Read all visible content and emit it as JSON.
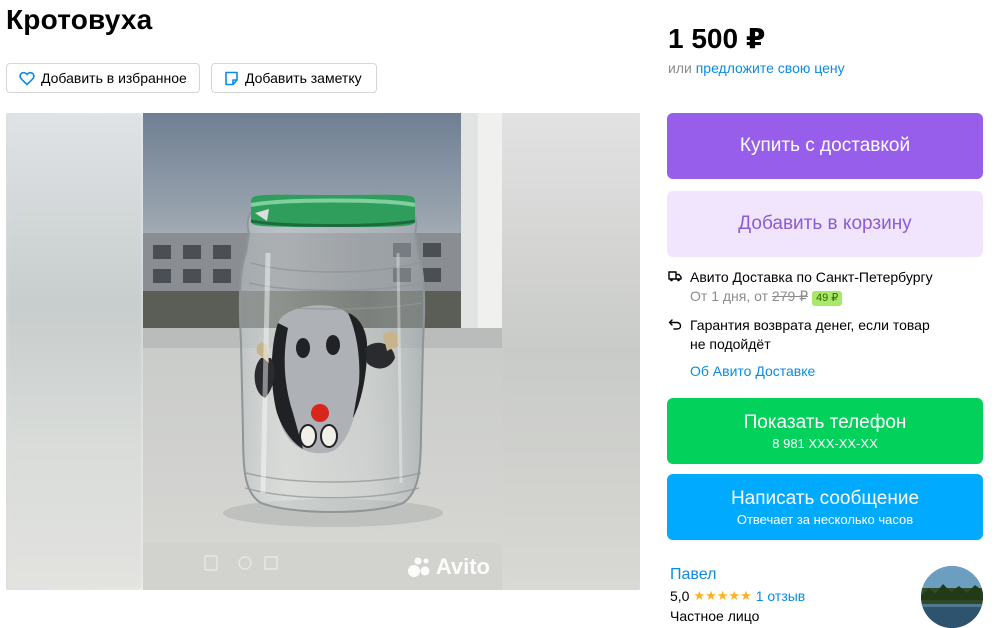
{
  "listing": {
    "title": "Кротовуха"
  },
  "actions": {
    "favorite_label": "Добавить в избранное",
    "note_label": "Добавить заметку"
  },
  "gallery": {
    "watermark": "Avito"
  },
  "price": {
    "value": "1 500 ₽",
    "or_label": "или",
    "offer_link": "предложите свою цену"
  },
  "buttons": {
    "buy_label": "Купить с доставкой",
    "cart_label": "Добавить в корзину",
    "phone_label": "Показать телефон",
    "phone_number": "8 981 XXX-XX-XX",
    "message_label": "Написать сообщение",
    "message_sub": "Отвечает за несколько часов"
  },
  "delivery": {
    "title": "Авито Доставка по Санкт-Петербургу",
    "terms_prefix": "От 1 дня, от",
    "old_price": "279 ₽",
    "new_price": "49 ₽",
    "guarantee_line1": "Гарантия возврата денег, если товар",
    "guarantee_line2": "не подойдёт",
    "about_link": "Об Авито Доставке"
  },
  "seller": {
    "name": "Павел",
    "rating": "5,0",
    "stars": "★★★★★",
    "reviews_link": "1 отзыв",
    "type": "Частное лицо"
  },
  "colors": {
    "buy": "#965eeb",
    "cart_bg": "#f1e5fd",
    "phone": "#02d15c",
    "message": "#00aaff",
    "link": "#0a8de0"
  }
}
